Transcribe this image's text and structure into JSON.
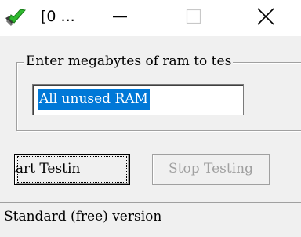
{
  "window": {
    "title": "[0 ...",
    "controls": {
      "minimize_icon": "minimize-icon",
      "maximize_icon": "maximize-icon",
      "close_icon": "close-icon"
    }
  },
  "memory_group": {
    "label": "Enter megabytes of ram to tes",
    "input_value": "All unused RAM"
  },
  "buttons": {
    "start_label": "tart Testin",
    "stop_label": "Stop Testing"
  },
  "status_bar": {
    "text": "Standard (free) version"
  },
  "colors": {
    "selection": "#0078d7",
    "window_bg": "#f0f0f0",
    "disabled_text": "#a0a0a0"
  }
}
